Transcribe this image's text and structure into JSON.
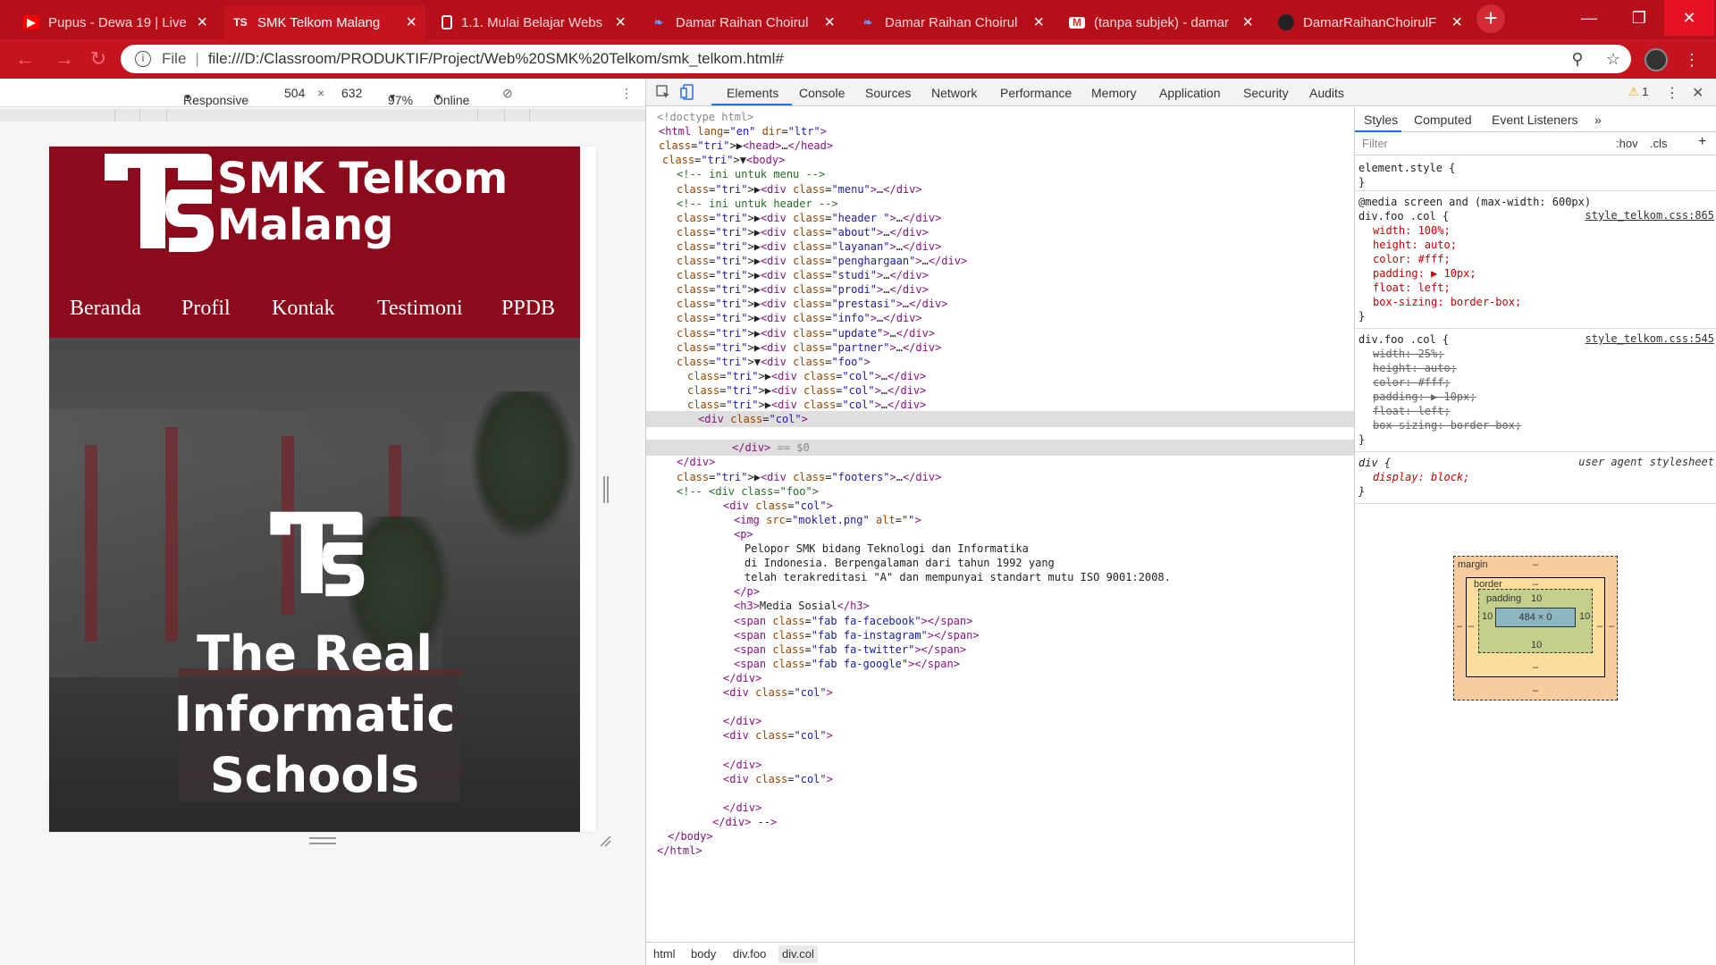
{
  "browser": {
    "tabs": [
      {
        "title": "Pupus - Dewa 19 | Live",
        "icon": "youtube-icon"
      },
      {
        "title": "SMK Telkom Malang",
        "icon": "telkom-icon"
      },
      {
        "title": "1.1. Mulai Belajar Webs",
        "icon": "document-icon"
      },
      {
        "title": "Damar Raihan Choirul",
        "icon": "feather-icon"
      },
      {
        "title": "Damar Raihan Choirul",
        "icon": "feather-icon"
      },
      {
        "title": "(tanpa subjek) - damar",
        "icon": "gmail-icon"
      },
      {
        "title": "DamarRaihanChoirulF",
        "icon": "github-icon"
      }
    ],
    "new_tab": "+",
    "url_scheme": "File",
    "url": "file:///D:/Classroom/PRODUKTIF/Project/Web%20SMK%20Telkom/smk_telkom.html#"
  },
  "device_toolbar": {
    "mode": "Responsive",
    "width": "504",
    "times": "×",
    "height": "632",
    "zoom": "97%",
    "network": "Online"
  },
  "site": {
    "brand_line1": "SMK Telkom",
    "brand_line2": "Malang",
    "nav": [
      "Beranda",
      "Profil",
      "Kontak",
      "Testimoni",
      "PPDB"
    ],
    "hero_line1": "The Real Informatic",
    "hero_line2": "Schools"
  },
  "devtools": {
    "tabs": [
      "Elements",
      "Console",
      "Sources",
      "Network",
      "Performance",
      "Memory",
      "Application",
      "Security",
      "Audits"
    ],
    "warning_count": "1",
    "elements_lines": [
      {
        "t": "<!doctype html>"
      },
      {
        "t": "<html lang=\"en\" dir=\"ltr\">"
      },
      {
        "t": "▶<head>…</head>"
      },
      {
        "t": "▼<body>"
      },
      {
        "t": "<!-- ini untuk menu -->"
      },
      {
        "t": "▶<div class=\"menu\">…</div>"
      },
      {
        "t": "<!-- ini untuk header -->"
      },
      {
        "t": "▶<div class=\"header \">…</div>"
      },
      {
        "t": "▶<div class=\"about\">…</div>"
      },
      {
        "t": "▶<div class=\"layanan\">…</div>"
      },
      {
        "t": "▶<div class=\"penghargaan\">…</div>"
      },
      {
        "t": "▶<div class=\"studi\">…</div>"
      },
      {
        "t": "▶<div class=\"prodi\">…</div>"
      },
      {
        "t": "▶<div class=\"prestasi\">…</div>"
      },
      {
        "t": "▶<div class=\"info\">…</div>"
      },
      {
        "t": "▶<div class=\"update\">…</div>"
      },
      {
        "t": "▶<div class=\"partner\">…</div>"
      },
      {
        "t": "▼<div class=\"foo\">"
      },
      {
        "t": "▶<div class=\"col\">…</div>"
      },
      {
        "t": "▶<div class=\"col\">…</div>"
      },
      {
        "t": "▶<div class=\"col\">…</div>"
      },
      {
        "t": "<div class=\"col\">"
      },
      {
        "t": ""
      },
      {
        "t": "</div> == $0"
      },
      {
        "t": "</div>"
      },
      {
        "t": "▶<div class=\"footers\">…</div>"
      },
      {
        "t": "<!-- <div class=\"foo\">"
      },
      {
        "t": "<div class=\"col\">"
      },
      {
        "t": "<img src=\"moklet.png\" alt=\"\">"
      },
      {
        "t": "<p>"
      },
      {
        "t": "Pelopor SMK bidang Teknologi dan Informatika"
      },
      {
        "t": "di Indonesia. Berpengalaman dari tahun 1992 yang"
      },
      {
        "t": "telah terakreditasi \"A\" dan mempunyai standart mutu ISO 9001:2008."
      },
      {
        "t": "</p>"
      },
      {
        "t": "<h3>Media Sosial</h3>"
      },
      {
        "t": "<span class=\"fab fa-facebook\"></span>"
      },
      {
        "t": "<span class=\"fab fa-instagram\"></span>"
      },
      {
        "t": "<span class=\"fab fa-twitter\"></span>"
      },
      {
        "t": "<span class=\"fab fa-google\"></span>"
      },
      {
        "t": "</div>"
      },
      {
        "t": "<div class=\"col\">"
      },
      {
        "t": ""
      },
      {
        "t": "</div>"
      },
      {
        "t": "<div class=\"col\">"
      },
      {
        "t": ""
      },
      {
        "t": "</div>"
      },
      {
        "t": "<div class=\"col\">"
      },
      {
        "t": ""
      },
      {
        "t": "</div>"
      },
      {
        "t": "</div> -->"
      },
      {
        "t": "</body>"
      },
      {
        "t": "</html>"
      }
    ],
    "breadcrumbs": [
      "html",
      "body",
      "div.foo",
      "div.col"
    ],
    "styles_tabs": [
      "Styles",
      "Computed",
      "Event Listeners"
    ],
    "filter_placeholder": "Filter",
    "hov": ":hov",
    "cls": ".cls",
    "rules": [
      {
        "selector": "element.style {",
        "end": "}"
      },
      {
        "media": "@media screen and (max-width: 600px)",
        "selector": "div.foo .col {",
        "source": "style_telkom.css:865",
        "props": [
          "width: 100%;",
          "height: auto;",
          "color: #fff;",
          "padding: ▶ 10px;",
          "float: left;",
          "box-sizing: border-box;"
        ],
        "end": "}"
      },
      {
        "selector": "div.foo .col {",
        "source": "style_telkom.css:545",
        "props": [
          "width: 25%;",
          "height: auto;",
          "color: #fff;",
          "padding: ▶ 10px;",
          "float: left;",
          "box-sizing: border-box;"
        ],
        "end": "}"
      },
      {
        "selector": "div {",
        "source": "user agent stylesheet",
        "props": [
          "display: block;"
        ],
        "end": "}"
      }
    ],
    "box_model": {
      "margin_label": "margin",
      "margin": "–",
      "border_label": "border",
      "border": "–",
      "padding_label": "padding",
      "padding_top": "10",
      "padding_bottom": "10",
      "padding_left": "10",
      "padding_right": "10",
      "content": "484 × 0"
    }
  }
}
